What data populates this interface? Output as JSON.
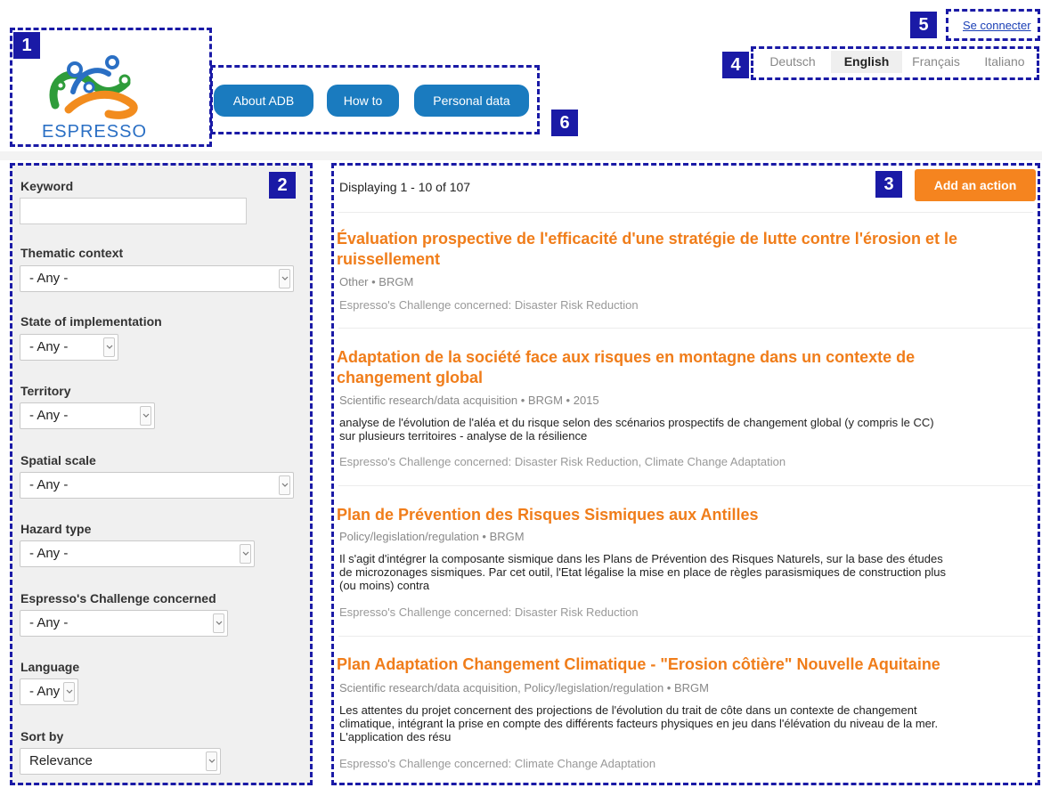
{
  "callouts": [
    "1",
    "2",
    "3",
    "4",
    "5",
    "6"
  ],
  "header": {
    "logo_text": "ESPRESSO",
    "nav": [
      "About ADB",
      "How to",
      "Personal data"
    ],
    "languages": [
      "Deutsch",
      "English",
      "Français",
      "Italiano"
    ],
    "active_language": "English",
    "login": "Se connecter"
  },
  "colors": {
    "accent_orange": "#f07d1a",
    "nav_blue": "#1a7bbf",
    "callout_blue": "#1a1aa6"
  },
  "filters": {
    "keyword_label": "Keyword",
    "keyword_value": "",
    "thematic_label": "Thematic context",
    "thematic_value": "- Any -",
    "state_label": "State of implementation",
    "state_value": "- Any -",
    "territory_label": "Territory",
    "territory_value": "- Any -",
    "spatial_label": "Spatial scale",
    "spatial_value": "- Any -",
    "hazard_label": "Hazard type",
    "hazard_value": "- Any -",
    "challenge_label": "Espresso's Challenge concerned",
    "challenge_value": "- Any -",
    "language_label": "Language",
    "language_value": "- Any -",
    "sort_label": "Sort by",
    "sort_value": "Relevance"
  },
  "results": {
    "count_text": "Displaying 1 - 10 of 107",
    "add_button": "Add an action",
    "items": [
      {
        "title_line1": "Évaluation prospective de l'efficacité d'une stratégie de lutte contre l'érosion et le",
        "title_line2": "ruissellement",
        "meta": "Other • BRGM",
        "challenge": "Espresso's Challenge concerned: Disaster Risk Reduction"
      },
      {
        "title_line1": "Adaptation de la société face aux risques en montagne dans un contexte de",
        "title_line2": "changement global",
        "meta": "Scientific research/data acquisition • BRGM • 2015",
        "desc_line1": "analyse de l'évolution de l'aléa et du risque selon des scénarios prospectifs de changement global (y compris le CC)",
        "desc_line2": "sur plusieurs territoires - analyse de la résilience",
        "challenge": "Espresso's Challenge concerned: Disaster Risk Reduction, Climate Change Adaptation"
      },
      {
        "title_line1": "Plan de Prévention des Risques Sismiques aux Antilles",
        "meta": "Policy/legislation/regulation • BRGM",
        "desc_line1": "Il s'agit d'intégrer la composante sismique dans les Plans de Prévention des Risques Naturels, sur la base des études",
        "desc_line2": "de microzonages sismiques. Par cet outil, l'Etat légalise la mise en place de règles parasismiques de construction plus",
        "desc_line3": "(ou moins) contra",
        "challenge": "Espresso's Challenge concerned: Disaster Risk Reduction"
      },
      {
        "title_line1": "Plan Adaptation Changement Climatique - \"Erosion côtière\" Nouvelle Aquitaine",
        "meta": "Scientific research/data acquisition, Policy/legislation/regulation • BRGM",
        "desc_line1": "Les attentes du projet concernent des projections de l'évolution du trait de côte dans un contexte de changement",
        "desc_line2": "climatique, intégrant la prise en compte des différents facteurs physiques en jeu dans l'élévation du niveau de la mer.",
        "desc_line3": "L'application des résu",
        "challenge": "Espresso's Challenge concerned: Climate Change Adaptation"
      }
    ]
  }
}
